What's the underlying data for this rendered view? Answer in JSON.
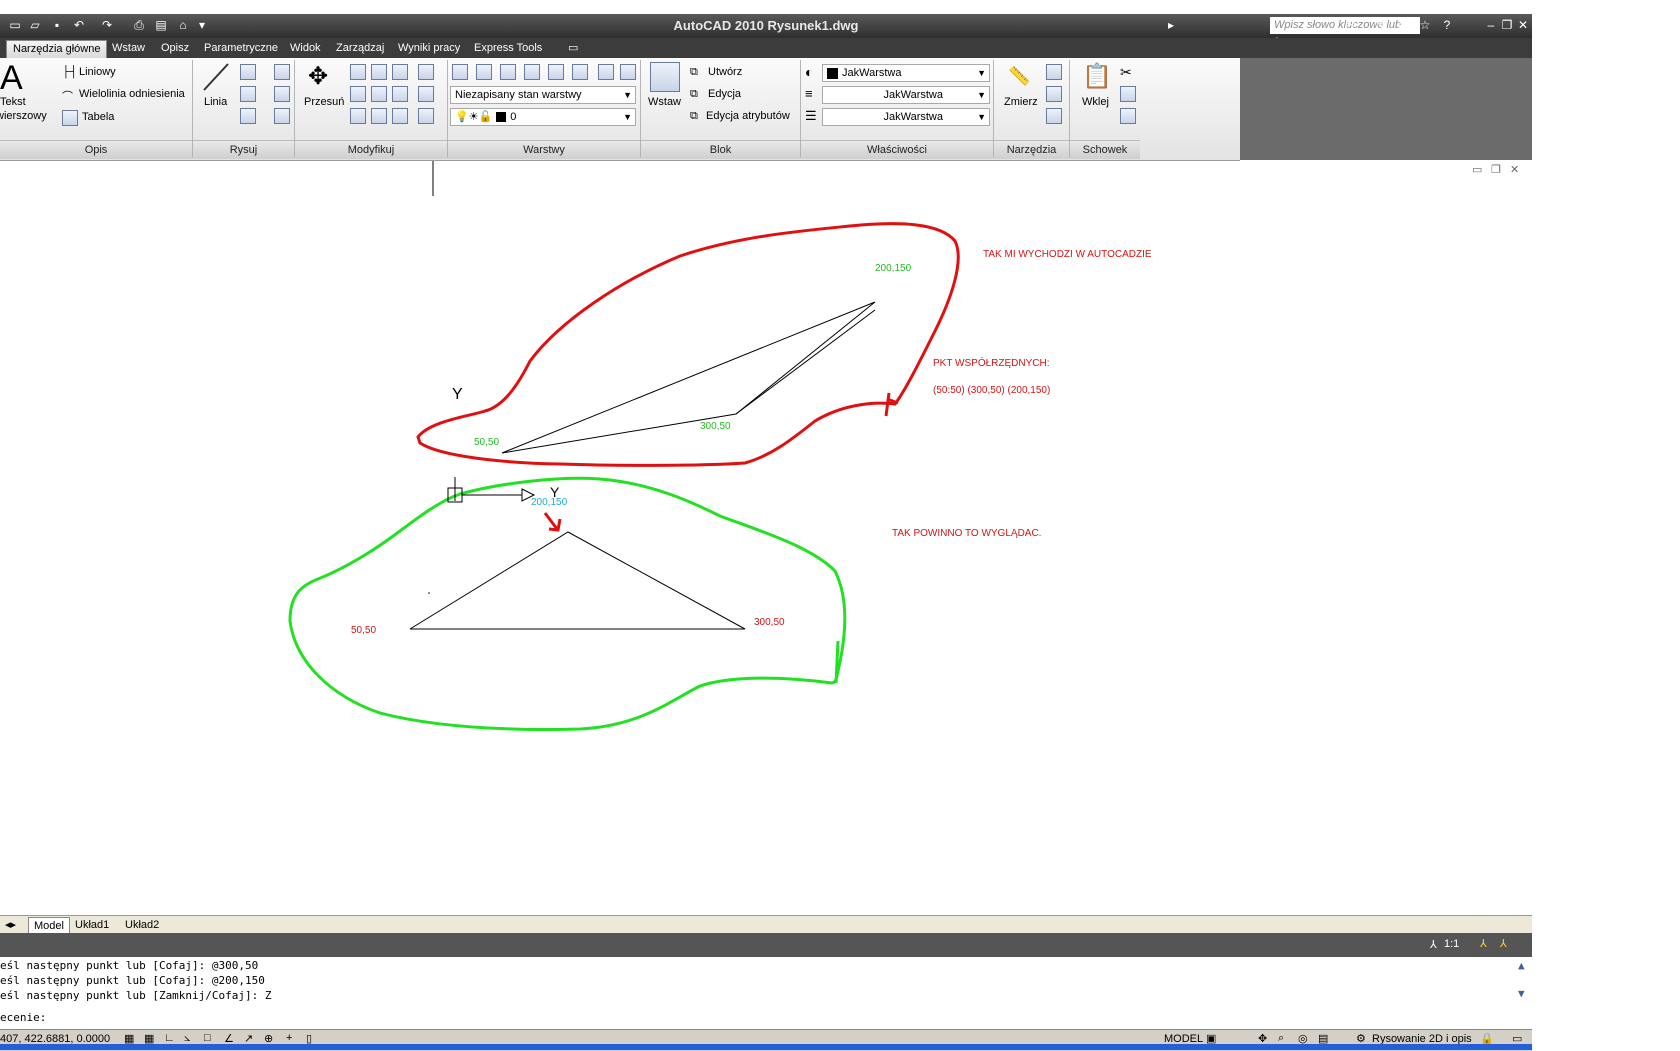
{
  "window": {
    "title": "AutoCAD 2010    Rysunek1.dwg",
    "search_placeholder": "Wpisz słowo kluczowe lub frazę"
  },
  "ribbon_tabs": [
    "Narzędzia główne",
    "Wstaw",
    "Opisz",
    "Parametryczne",
    "Widok",
    "Zarządzaj",
    "Wyniki pracy",
    "Express Tools"
  ],
  "ribbon": {
    "opis": {
      "title": "Opis",
      "tekst": "Tekst",
      "wierszowy": "wierszowy",
      "liniowy": "Liniowy",
      "wielolinia": "Wielolinia odniesienia",
      "tabela": "Tabela"
    },
    "rysuj": {
      "title": "Rysuj",
      "linia": "Linia"
    },
    "modyfikuj": {
      "title": "Modyfikuj",
      "przesun": "Przesuń"
    },
    "warstwy": {
      "title": "Warstwy",
      "state": "Niezapisany stan warstwy",
      "layer": "0"
    },
    "blok": {
      "title": "Blok",
      "wstaw": "Wstaw",
      "utworz": "Utwórz",
      "edycja": "Edycja",
      "edycja_atr": "Edycja atrybutów"
    },
    "wlasciwosci": {
      "title": "Właściwości",
      "color": "JakWarstwa",
      "linetype": "JakWarstwa",
      "lineweight": "JakWarstwa"
    },
    "narzedzia": {
      "title": "Narzędzia",
      "zmierz": "Zmierz"
    },
    "schowek": {
      "title": "Schowek",
      "wklej": "Wklej"
    }
  },
  "drawing": {
    "note_red": "TAK MI WYCHODZI W AUTOCADZIE",
    "note_coords_title": "PKT WSPÓŁRZĘDNYCH:",
    "note_coords": "(50:50) (300,50) (200,150)",
    "note_green": "TAK POWINNO TO WYGLĄDAC.",
    "top_labels": [
      "50,50",
      "300,50",
      "200,150"
    ],
    "bottom_labels": [
      "50,50",
      "300,50",
      "200,150"
    ],
    "ucs_y": "Y"
  },
  "layout_tabs": [
    "Model",
    "Układ1",
    "Układ2"
  ],
  "scale": "1:1",
  "command_lines": [
    "eśl następny punkt lub [Cofaj]: @300,50",
    "eśl następny punkt lub [Cofaj]: @200,150",
    "eśl następny punkt lub [Zamknij/Cofaj]: Z",
    "ecenie:"
  ],
  "status": {
    "coords": "407, 422.6881, 0.0000",
    "model": "MODEL",
    "workspace": "Rysowanie 2D i opis"
  },
  "colors": {
    "red_outline": "#e01010",
    "green_outline": "#22e022",
    "note_red": "#d01515"
  }
}
